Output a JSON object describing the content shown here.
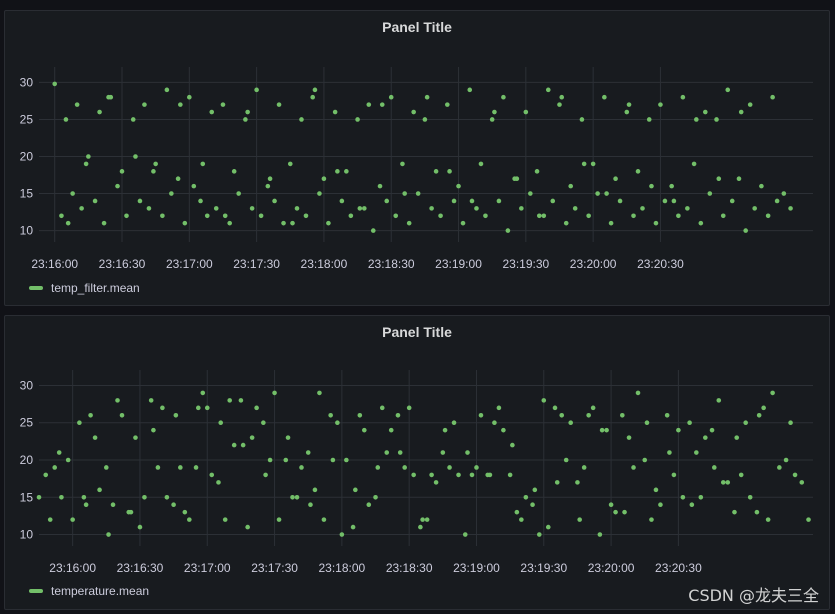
{
  "panels": [
    {
      "title": "Panel Title",
      "legend": "temp_filter.mean"
    },
    {
      "title": "Panel Title",
      "legend": "temperature.mean"
    }
  ],
  "watermark": "CSDN @龙夫三全",
  "colors": {
    "series": "#73bf69",
    "grid": "#2c3036",
    "background": "#181b1f"
  },
  "chart_data": [
    {
      "type": "scatter",
      "title": "Panel Title",
      "xlabel": "",
      "ylabel": "",
      "x_ticks": [
        "23:16:00",
        "23:16:30",
        "23:17:00",
        "23:17:30",
        "23:18:00",
        "23:18:30",
        "23:19:00",
        "23:19:30",
        "23:20:00",
        "23:20:30"
      ],
      "y_ticks": [
        10,
        15,
        20,
        25,
        30
      ],
      "ylim": [
        9,
        31
      ],
      "xlim_seconds": [
        -7,
        338
      ],
      "series": [
        {
          "name": "temp_filter.mean",
          "x_seconds": [
            0,
            3,
            5,
            8,
            10,
            12,
            15,
            18,
            20,
            22,
            25,
            28,
            30,
            32,
            35,
            38,
            40,
            42,
            45,
            48,
            50,
            52,
            55,
            58,
            60,
            62,
            65,
            68,
            70,
            72,
            75,
            78,
            80,
            82,
            85,
            88,
            90,
            92,
            95,
            98,
            100,
            102,
            105,
            108,
            110,
            112,
            115,
            118,
            120,
            122,
            125,
            128,
            130,
            132,
            135,
            138,
            140,
            142,
            145,
            148,
            150,
            152,
            155,
            158,
            160,
            162,
            165,
            168,
            170,
            172,
            175,
            178,
            180,
            182,
            185,
            188,
            190,
            192,
            195,
            198,
            200,
            202,
            205,
            208,
            210,
            212,
            215,
            218,
            220,
            222,
            225,
            228,
            230,
            232,
            235,
            238,
            240,
            242,
            245,
            248,
            250,
            252,
            255,
            258,
            260,
            262,
            265,
            268,
            270,
            272,
            275,
            278,
            280,
            282,
            285,
            288,
            290,
            292,
            295,
            298,
            300,
            302,
            305,
            308,
            310,
            312,
            315,
            318,
            320,
            322,
            325,
            328,
            6,
            14,
            24,
            36,
            44,
            56,
            66,
            76,
            86,
            96,
            106,
            116,
            126,
            136,
            146,
            156,
            166,
            176,
            186,
            196,
            206,
            216,
            226,
            236,
            246,
            256,
            266,
            276,
            286,
            296,
            306,
            316,
            326
          ],
          "y": [
            29.8,
            12,
            25,
            15,
            27,
            13,
            20,
            14,
            26,
            11,
            28,
            16,
            18,
            12,
            25,
            14,
            27,
            13,
            19,
            12,
            29,
            15,
            17,
            11,
            28,
            16,
            14,
            12,
            26,
            13,
            27,
            11,
            18,
            15,
            25,
            13,
            29,
            12,
            16,
            14,
            27,
            11,
            19,
            13,
            25,
            12,
            28,
            15,
            17,
            11,
            26,
            14,
            18,
            12,
            25,
            13,
            27,
            10,
            16,
            14,
            28,
            12,
            19,
            11,
            26,
            15,
            25,
            13,
            18,
            12,
            27,
            14,
            16,
            11,
            29,
            13,
            19,
            12,
            25,
            14,
            28,
            10,
            17,
            13,
            26,
            15,
            18,
            12,
            29,
            14,
            27,
            11,
            16,
            13,
            25,
            12,
            19,
            15,
            28,
            11,
            17,
            14,
            26,
            12,
            18,
            13,
            25,
            11,
            27,
            14,
            16,
            12,
            28,
            13,
            19,
            11,
            26,
            15,
            25,
            12,
            29,
            14,
            17,
            10,
            27,
            13,
            16,
            12,
            28,
            14,
            15,
            13,
            11,
            19,
            28,
            20,
            18,
            27,
            19,
            12,
            26,
            17,
            11,
            29,
            18,
            13,
            27,
            15,
            28,
            18,
            14,
            26,
            17,
            12,
            28,
            19,
            15,
            27,
            16,
            14,
            25,
            17,
            26
          ],
          "point_color": "#73bf69"
        }
      ]
    },
    {
      "type": "scatter",
      "title": "Panel Title",
      "xlabel": "",
      "ylabel": "",
      "x_ticks": [
        "23:16:00",
        "23:16:30",
        "23:17:00",
        "23:17:30",
        "23:18:00",
        "23:18:30",
        "23:19:00",
        "23:19:30",
        "23:20:00",
        "23:20:30"
      ],
      "y_ticks": [
        10,
        15,
        20,
        25,
        30
      ],
      "ylim": [
        9,
        31
      ],
      "xlim_seconds": [
        -15,
        330
      ],
      "series": [
        {
          "name": "temperature.mean",
          "x_seconds": [
            -15,
            -12,
            -10,
            -8,
            -5,
            -2,
            0,
            3,
            5,
            8,
            10,
            12,
            15,
            18,
            20,
            22,
            25,
            28,
            30,
            32,
            35,
            38,
            40,
            42,
            45,
            48,
            50,
            52,
            55,
            58,
            60,
            62,
            65,
            68,
            70,
            72,
            75,
            78,
            80,
            82,
            85,
            88,
            90,
            92,
            95,
            98,
            100,
            102,
            105,
            108,
            110,
            112,
            115,
            118,
            120,
            122,
            125,
            128,
            130,
            132,
            135,
            138,
            140,
            142,
            145,
            148,
            150,
            152,
            155,
            158,
            160,
            162,
            165,
            168,
            170,
            172,
            175,
            178,
            180,
            182,
            185,
            188,
            190,
            192,
            195,
            198,
            200,
            202,
            205,
            208,
            210,
            212,
            215,
            218,
            220,
            222,
            225,
            228,
            230,
            232,
            235,
            238,
            240,
            242,
            245,
            248,
            250,
            252,
            255,
            258,
            260,
            262,
            265,
            268,
            270,
            272,
            275,
            278,
            280,
            282,
            285,
            288,
            290,
            292,
            295,
            298,
            300,
            302,
            305,
            308,
            310,
            312,
            315,
            318,
            320,
            322,
            325,
            328,
            -6,
            6,
            16,
            26,
            36,
            46,
            56,
            66,
            76,
            86,
            96,
            106,
            116,
            126,
            136,
            146,
            156,
            166,
            176,
            186,
            196,
            206,
            216,
            226,
            236,
            246,
            256,
            266,
            276,
            286,
            296,
            306,
            316,
            326
          ],
          "y": [
            15,
            18,
            12,
            19,
            15,
            20,
            12,
            25,
            15,
            26,
            23,
            16,
            19,
            14,
            28,
            26,
            13,
            23,
            11,
            15,
            28,
            19,
            27,
            15,
            14,
            19,
            13,
            12,
            19,
            29,
            27,
            18,
            17,
            12,
            28,
            22,
            28,
            11,
            23,
            27,
            25,
            20,
            29,
            12,
            20,
            15,
            15,
            19,
            21,
            16,
            29,
            12,
            26,
            25,
            10,
            20,
            11,
            26,
            24,
            14,
            15,
            27,
            21,
            24,
            26,
            19,
            27,
            18,
            11,
            12,
            18,
            17,
            21,
            19,
            25,
            18,
            10,
            18,
            19,
            26,
            18,
            25,
            27,
            24,
            18,
            13,
            12,
            15,
            14,
            10,
            28,
            11,
            27,
            26,
            20,
            25,
            17,
            19,
            26,
            27,
            10,
            24,
            14,
            13,
            26,
            23,
            19,
            29,
            20,
            12,
            16,
            14,
            26,
            18,
            24,
            15,
            25,
            21,
            15,
            23,
            24,
            28,
            17,
            17,
            13,
            18,
            25,
            15,
            13,
            27,
            12,
            29,
            19,
            20,
            25,
            18,
            17,
            12,
            21,
            14,
            10,
            13,
            24,
            26,
            27,
            25,
            22,
            18,
            23,
            14,
            20,
            16,
            19,
            21,
            12,
            24,
            21,
            18,
            22,
            16,
            17,
            12,
            24,
            13,
            25,
            21,
            14,
            19,
            23,
            26
          ],
          "point_color": "#73bf69"
        }
      ]
    }
  ]
}
